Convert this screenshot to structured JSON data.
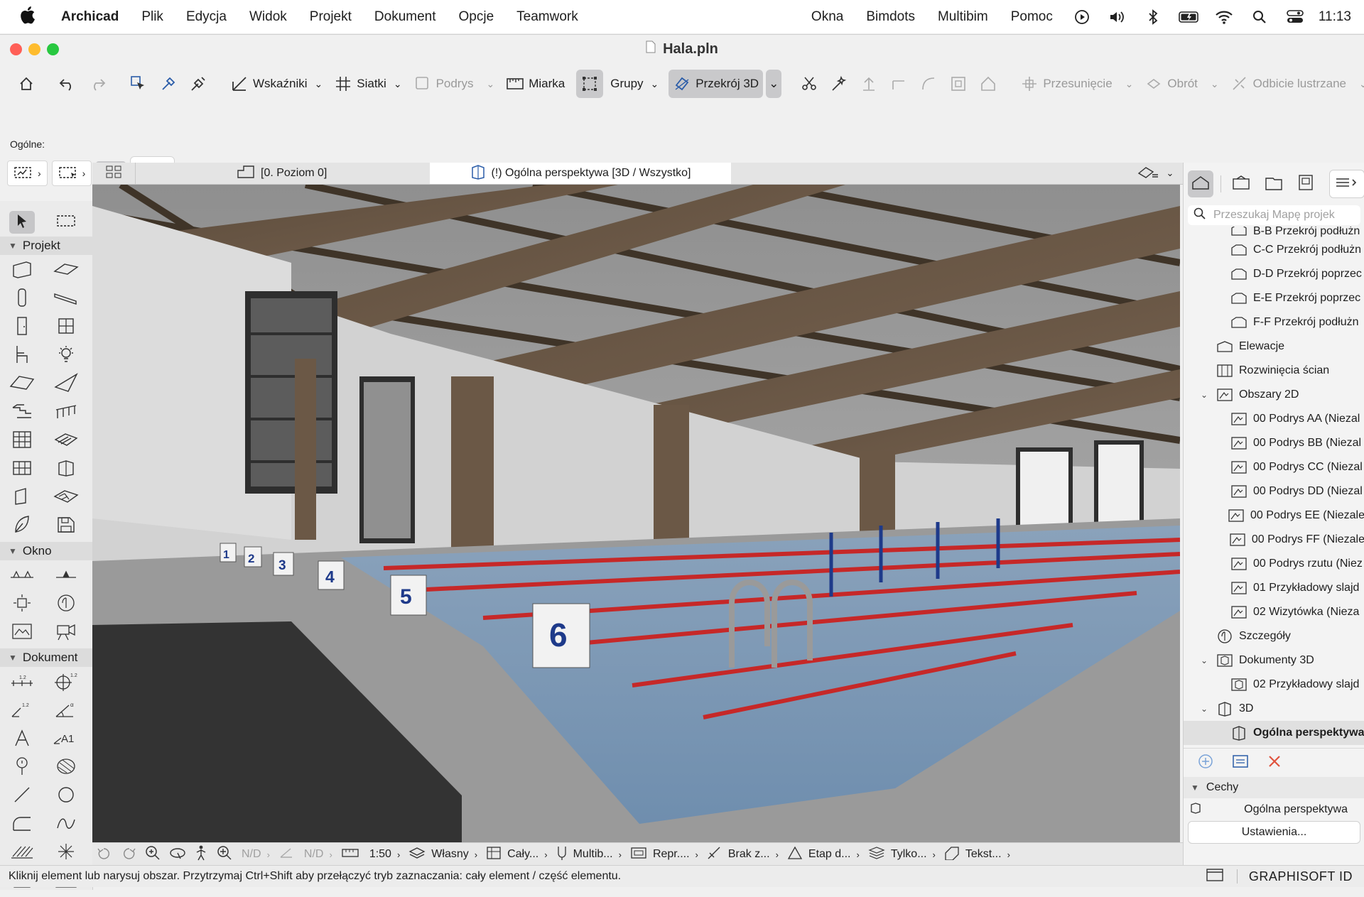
{
  "menubar": {
    "apple_icon": "apple-logo",
    "app_name": "Archicad",
    "items": [
      "Plik",
      "Edycja",
      "Widok",
      "Projekt",
      "Dokument",
      "Opcje",
      "Teamwork"
    ],
    "right_items": [
      "Okna",
      "Bimdots",
      "Multibim",
      "Pomoc"
    ],
    "status_icons": [
      "play-icon",
      "volume-icon",
      "bluetooth-icon",
      "battery-icon",
      "wifi-icon",
      "search-icon",
      "control-center-icon"
    ],
    "clock": "11:13"
  },
  "window": {
    "title": "Hala.pln",
    "traffic_colors": {
      "close": "#ff5f57",
      "minimize": "#febc2e",
      "zoom": "#28c840"
    }
  },
  "toolbar": {
    "wskazniki": "Wskaźniki",
    "siatki": "Siatki",
    "podrys": "Podrys",
    "miarka": "Miarka",
    "grupy": "Grupy",
    "przekroj3d": "Przekrój 3D",
    "przesuniecie": "Przesunięcie",
    "obrot": "Obrót",
    "odbicie": "Odbicie lustrzane"
  },
  "info_box": {
    "label": "Ogólne:"
  },
  "toolbox": {
    "sections": {
      "projekt": "Projekt",
      "okno": "Okno",
      "dokument": "Dokument"
    }
  },
  "view_tabs": {
    "tab1": "[0. Poziom 0]",
    "tab2": "(!) Ogólna perspektywa [3D / Wszystko]"
  },
  "pool": {
    "blocks": [
      "1",
      "2",
      "3",
      "4",
      "5",
      "6"
    ]
  },
  "view_bar": {
    "nd1": "N/D",
    "nd2": "N/D",
    "scale": "1:50",
    "pen": "Własny",
    "model": "Cały...",
    "multib": "Multib...",
    "repr": "Repr....",
    "brak": "Brak z...",
    "etap": "Etap d...",
    "tylko": "Tylko...",
    "tekst": "Tekst..."
  },
  "status_bar": {
    "message": "Kliknij element lub narysuj obszar. Przytrzymaj Ctrl+Shift aby przełączyć tryb zaznaczania: cały element / część elementu.",
    "brand": "GRAPHISOFT ID"
  },
  "navigator": {
    "search_placeholder": "Przeszukaj Mapę projek",
    "items": [
      {
        "label": "B-B Przekrój podłużn",
        "level": 2,
        "icon": "section-icon"
      },
      {
        "label": "C-C Przekrój podłużn",
        "level": 2,
        "icon": "section-icon"
      },
      {
        "label": "D-D Przekrój poprzec",
        "level": 2,
        "icon": "section-icon"
      },
      {
        "label": "E-E Przekrój poprzec",
        "level": 2,
        "icon": "section-icon"
      },
      {
        "label": "F-F Przekrój podłużn",
        "level": 2,
        "icon": "section-icon"
      },
      {
        "label": "Elewacje",
        "level": 1,
        "icon": "elevation-icon"
      },
      {
        "label": "Rozwinięcia ścian",
        "level": 1,
        "icon": "interior-elevation-icon"
      },
      {
        "label": "Obszary 2D",
        "level": 1,
        "icon": "worksheet-icon",
        "expanded": true
      },
      {
        "label": "00 Podrys AA (Niezal",
        "level": 2,
        "icon": "worksheet-icon"
      },
      {
        "label": "00 Podrys BB (Niezal",
        "level": 2,
        "icon": "worksheet-icon"
      },
      {
        "label": "00 Podrys CC (Niezal",
        "level": 2,
        "icon": "worksheet-icon"
      },
      {
        "label": "00 Podrys DD (Niezal",
        "level": 2,
        "icon": "worksheet-icon"
      },
      {
        "label": "00 Podrys EE (Niezale",
        "level": 2,
        "icon": "worksheet-icon"
      },
      {
        "label": "00 Podrys FF (Niezale",
        "level": 2,
        "icon": "worksheet-icon"
      },
      {
        "label": "00 Podrys rzutu (Niez",
        "level": 2,
        "icon": "worksheet-icon"
      },
      {
        "label": "01 Przykładowy slajd",
        "level": 2,
        "icon": "worksheet-icon"
      },
      {
        "label": "02 Wizytówka (Nieza",
        "level": 2,
        "icon": "worksheet-icon"
      },
      {
        "label": "Szczegóły",
        "level": 1,
        "icon": "detail-icon"
      },
      {
        "label": "Dokumenty 3D",
        "level": 1,
        "icon": "document-3d-icon",
        "expanded": true
      },
      {
        "label": "02 Przykładowy slajd",
        "level": 2,
        "icon": "document-3d-icon"
      },
      {
        "label": "3D",
        "level": 1,
        "icon": "3d-icon",
        "expanded": true
      },
      {
        "label": "Ogólna perspektywa",
        "level": 2,
        "icon": "3d-icon",
        "selected": true
      }
    ],
    "properties_title": "Cechy",
    "properties_value": "Ogólna perspektywa",
    "settings_button": "Ustawienia..."
  }
}
